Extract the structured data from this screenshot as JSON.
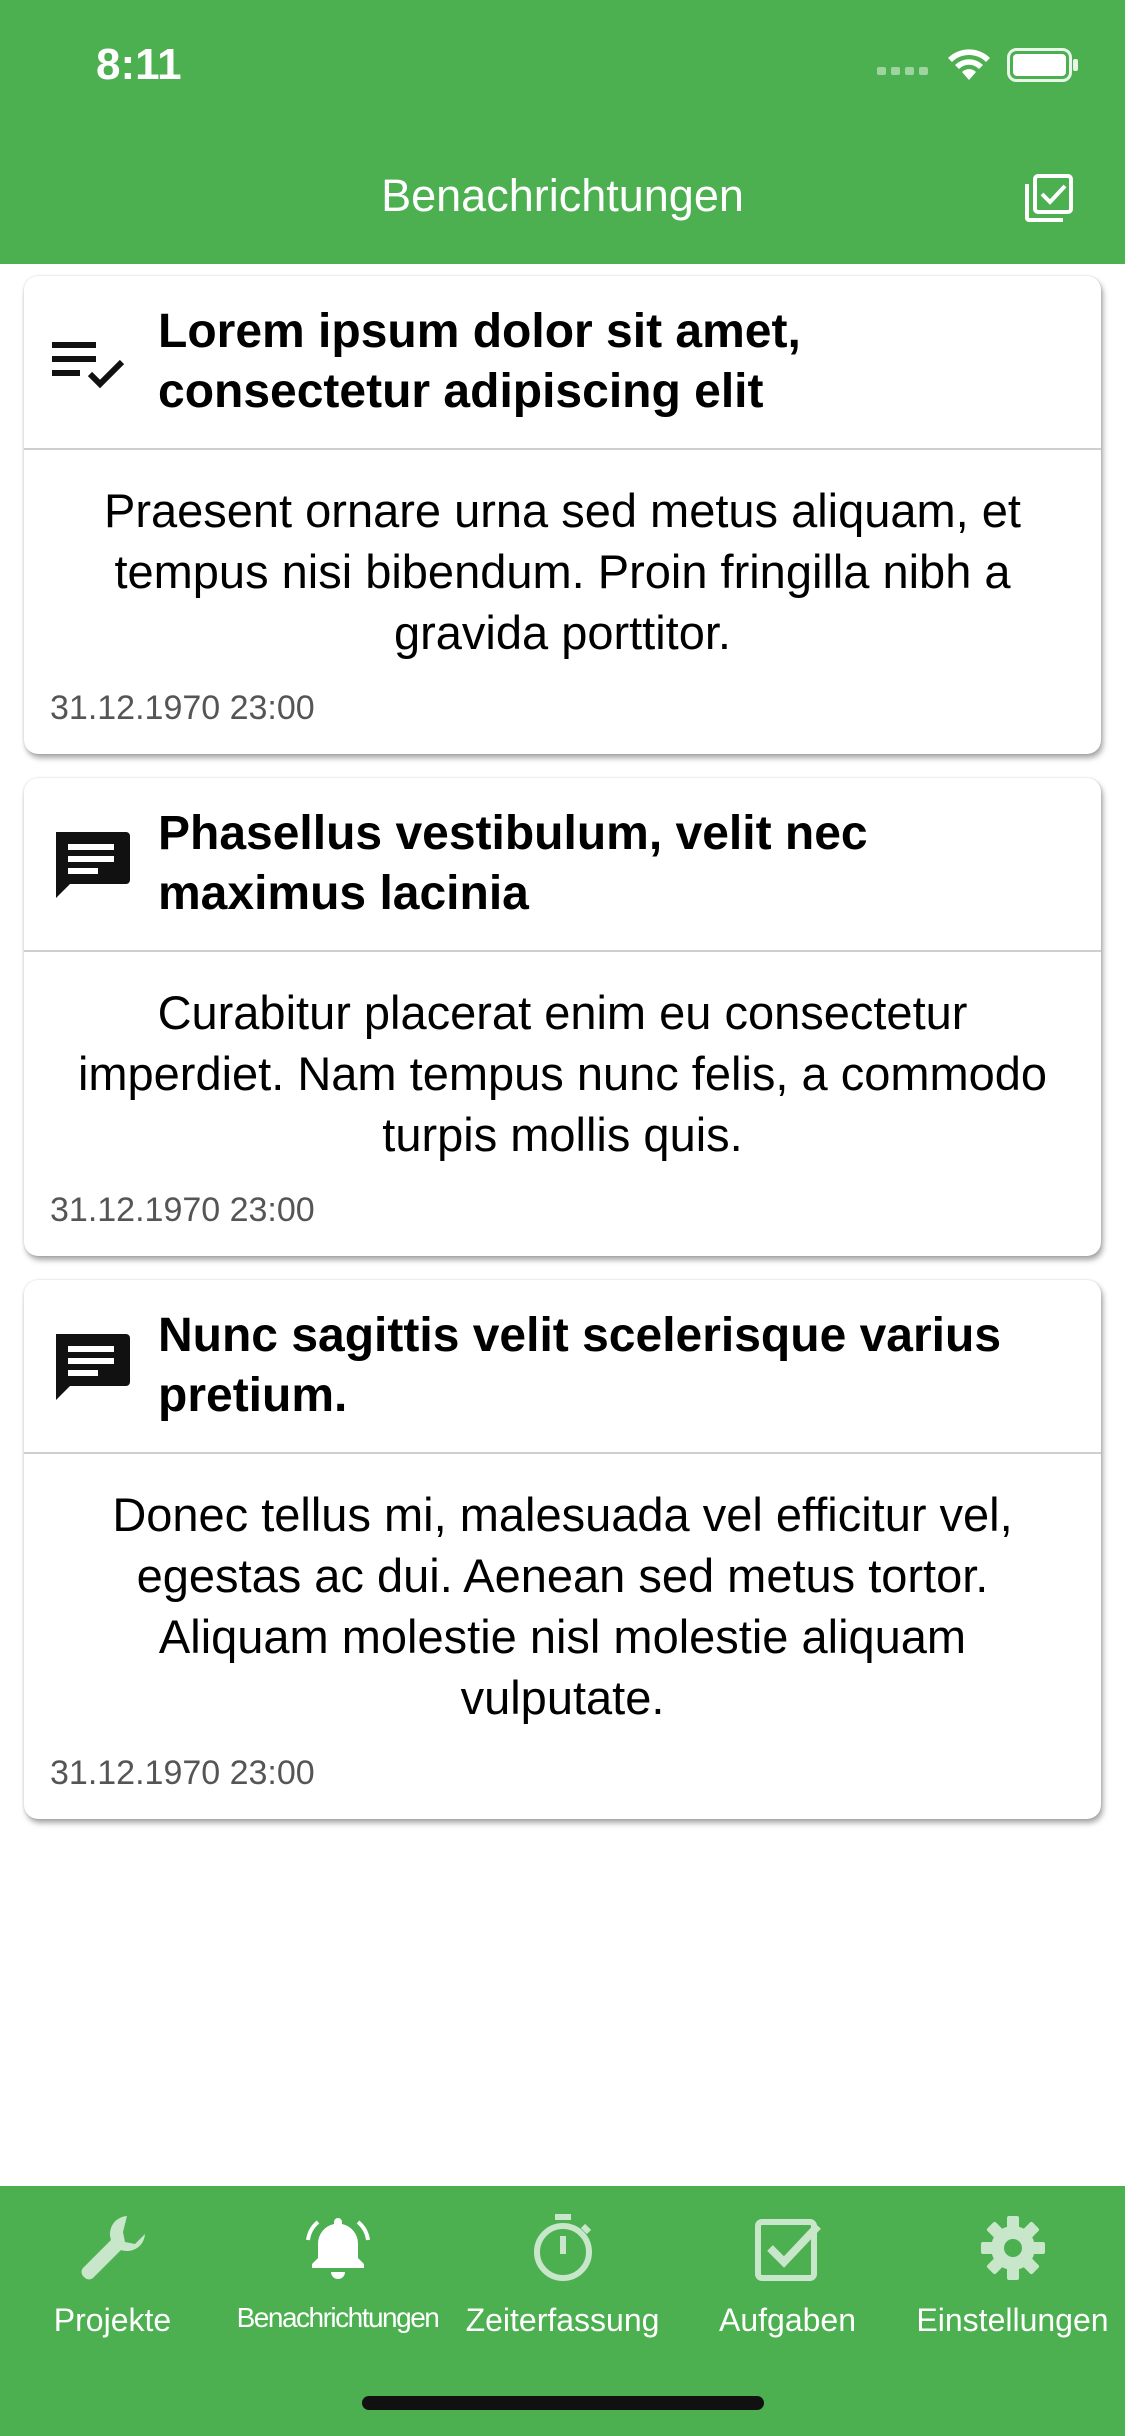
{
  "status_bar": {
    "time": "8:11"
  },
  "header": {
    "title": "Benachrichtungen",
    "action_icon": "mark-all-read-icon"
  },
  "notifications": [
    {
      "icon": "checklist-icon",
      "title": "Lorem ipsum dolor sit amet, consectetur adipiscing elit",
      "body": "Praesent ornare urna sed metus aliquam, et tempus nisi bibendum. Proin fringilla nibh a gravida porttitor.",
      "date": "31.12.1970 23:00"
    },
    {
      "icon": "message-icon",
      "title": "Phasellus vestibulum, velit nec maximus lacinia",
      "body": "Curabitur placerat enim eu consectetur imperdiet. Nam tempus nunc felis, a commodo turpis mollis quis.",
      "date": "31.12.1970 23:00"
    },
    {
      "icon": "message-icon",
      "title": "Nunc sagittis velit scelerisque varius pretium.",
      "body": "Donec tellus mi, malesuada vel efficitur vel, egestas ac dui. Aenean sed metus tortor. Aliquam molestie nisl molestie aliquam vulputate.",
      "date": "31.12.1970 23:00"
    }
  ],
  "tabbar": {
    "tabs": [
      {
        "label": "Projekte",
        "icon": "wrench-icon",
        "active": false
      },
      {
        "label": "Benachrichtungen",
        "icon": "bell-icon",
        "active": true
      },
      {
        "label": "Zeiterfassung",
        "icon": "stopwatch-icon",
        "active": false
      },
      {
        "label": "Aufgaben",
        "icon": "checkbox-icon",
        "active": false
      },
      {
        "label": "Einstellungen",
        "icon": "gear-icon",
        "active": false
      }
    ]
  },
  "colors": {
    "brand_green": "#4caf50",
    "active_tab": "#ffffff",
    "inactive_tab": "#c8e6c9"
  }
}
